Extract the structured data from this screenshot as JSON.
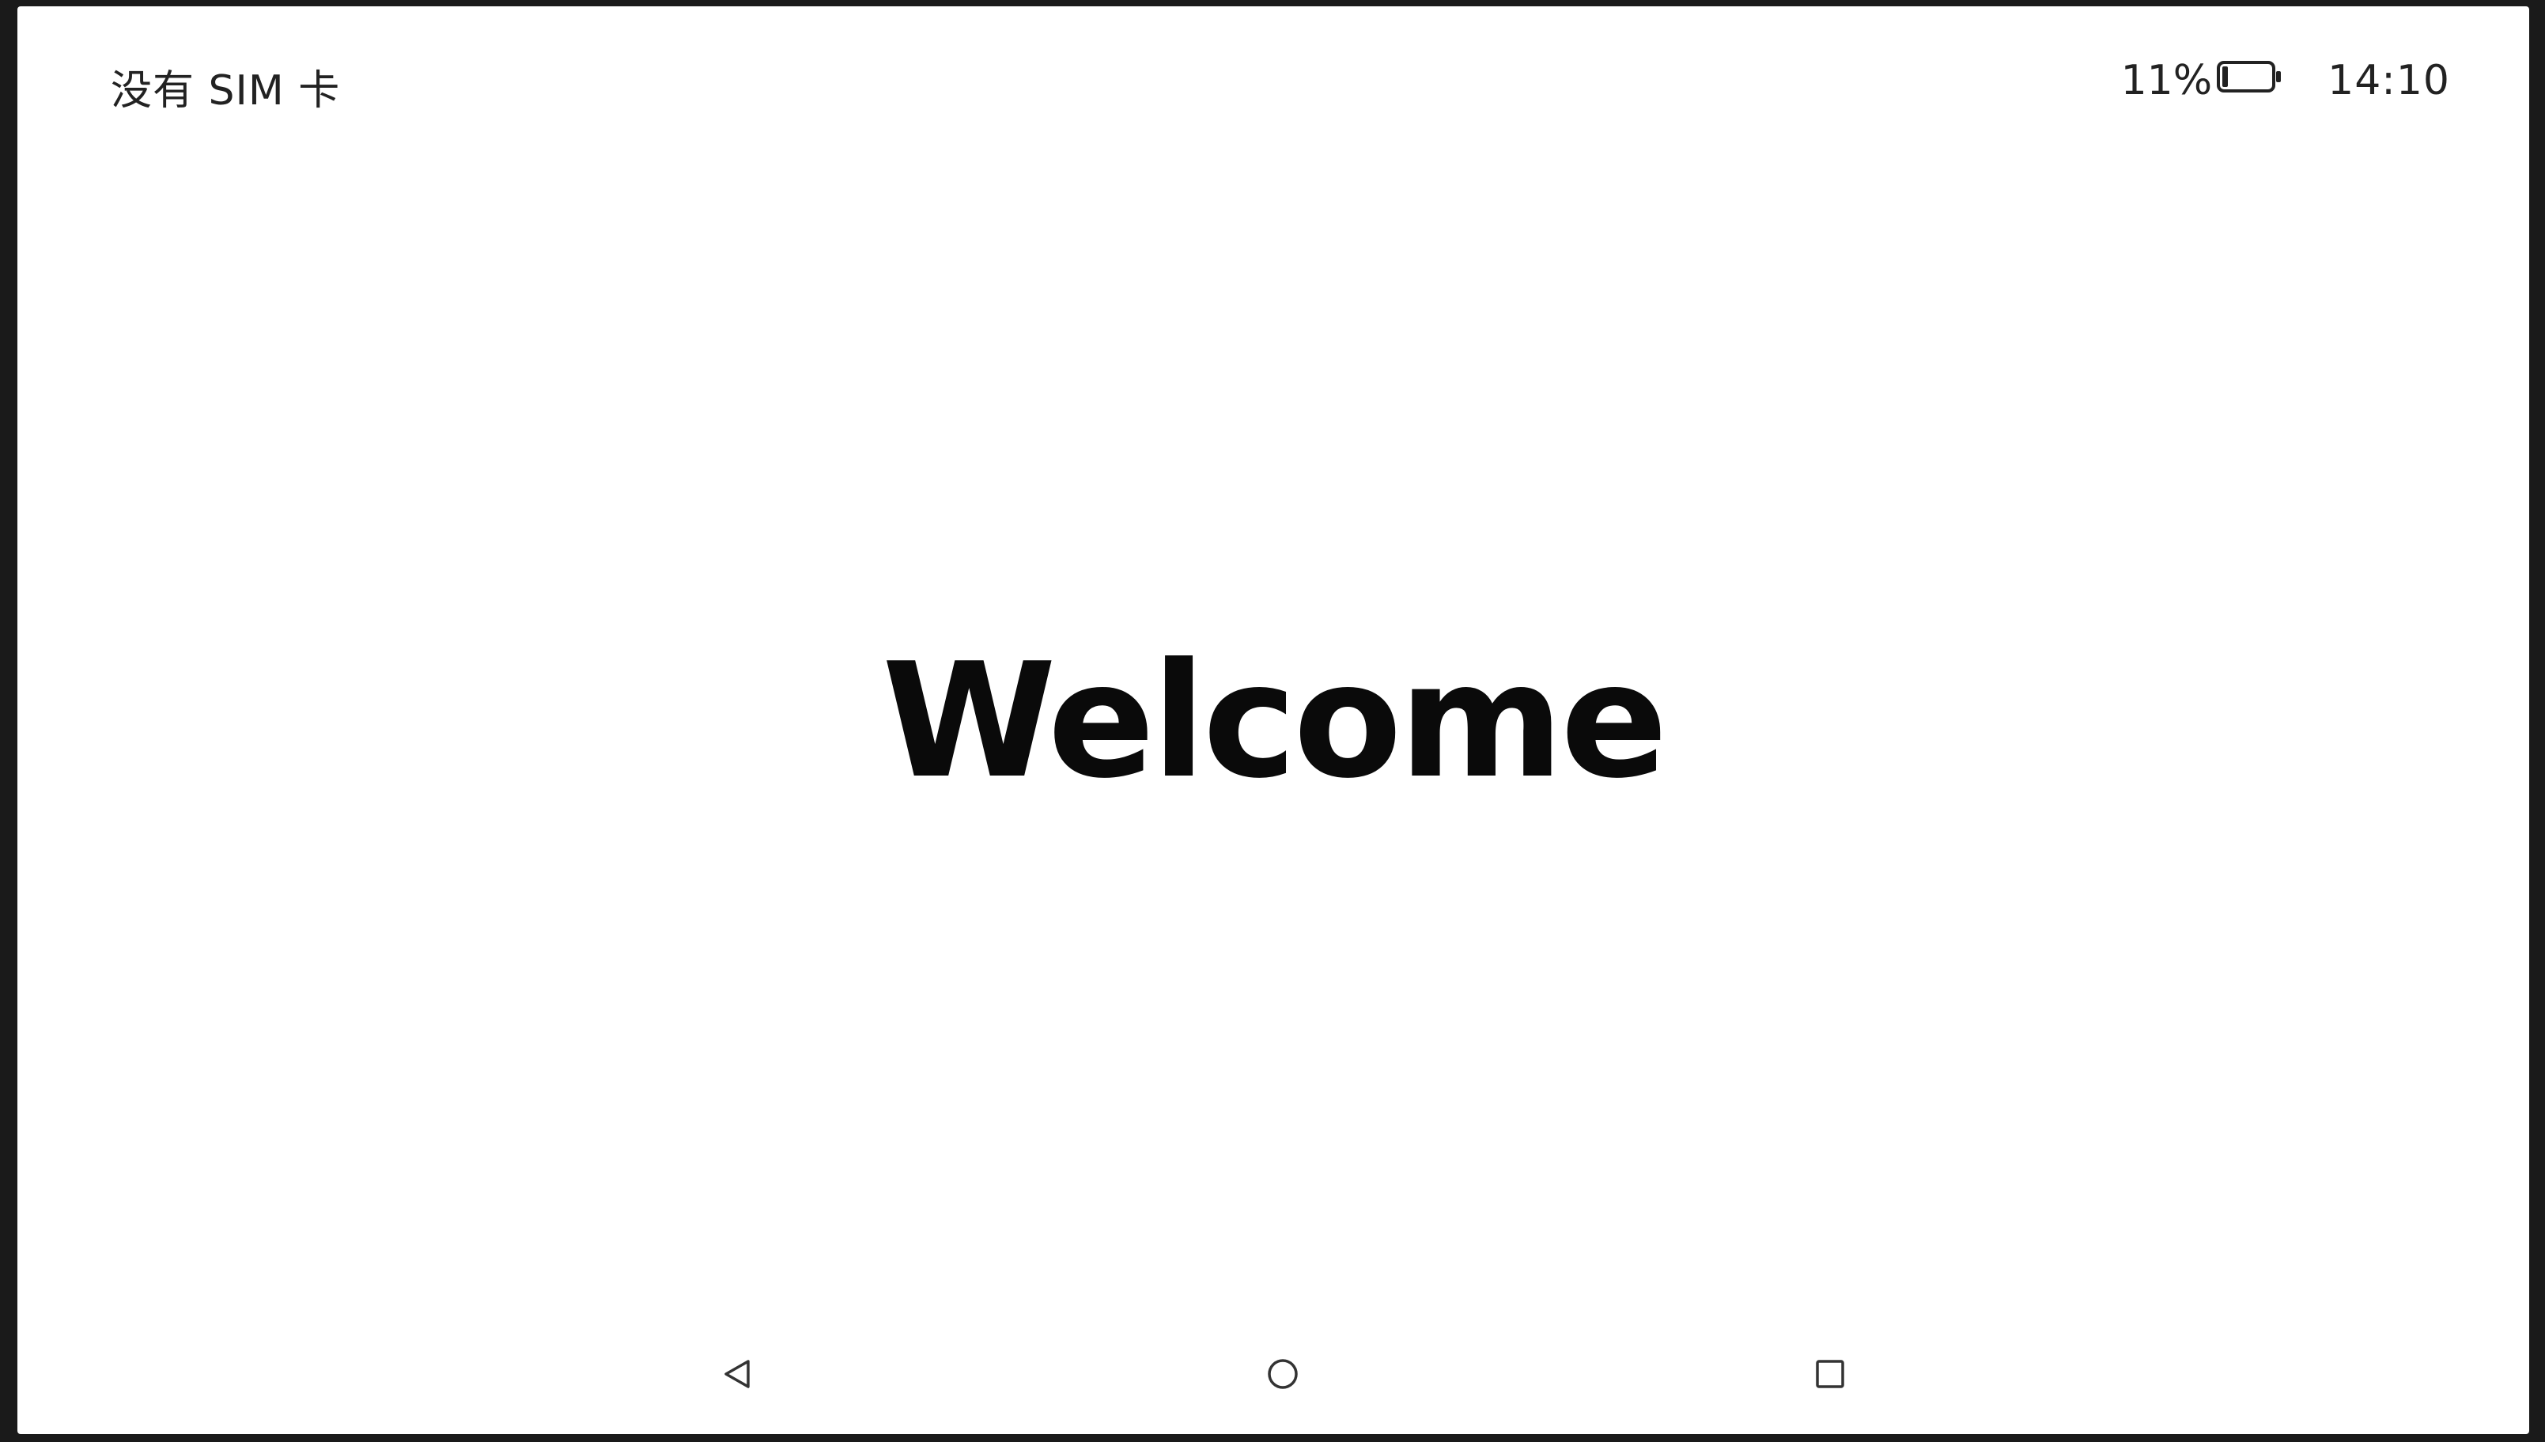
{
  "status_bar": {
    "carrier": "没有 SIM 卡",
    "battery_percent": "11%",
    "battery_level": 0.11,
    "time": "14:10",
    "battery_icon": "battery-icon"
  },
  "main": {
    "welcome_text": "Welcome"
  },
  "nav_bar": {
    "back_icon": "back-triangle-icon",
    "home_icon": "home-circle-icon",
    "recent_icon": "recent-square-icon"
  }
}
